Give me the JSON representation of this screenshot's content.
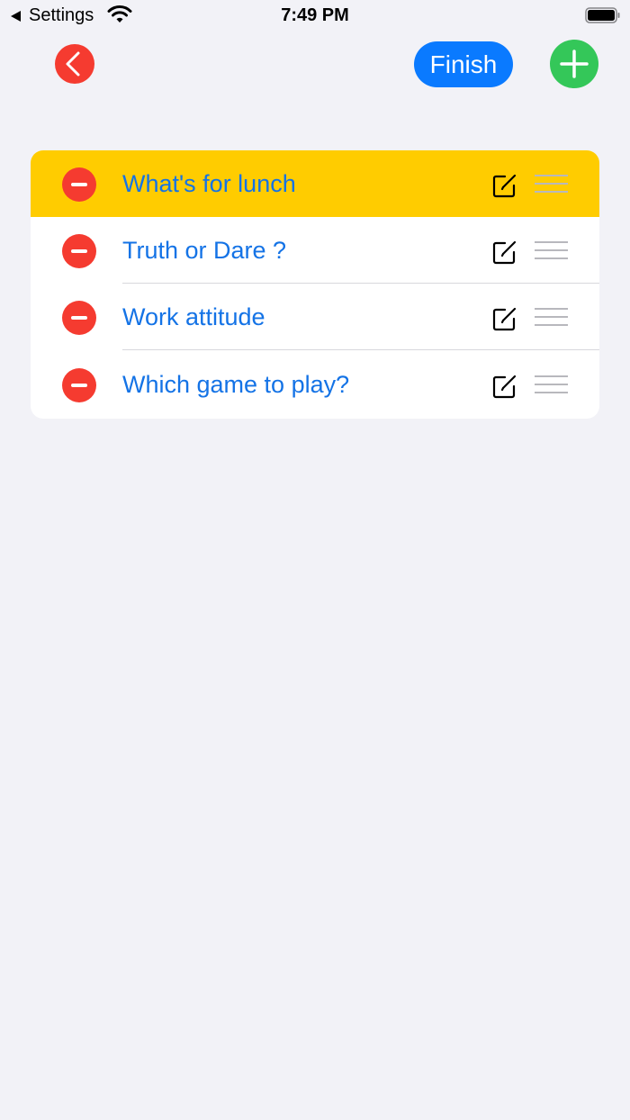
{
  "status_bar": {
    "back_label": "Settings",
    "time": "7:49 PM"
  },
  "toolbar": {
    "finish_label": "Finish"
  },
  "list": {
    "items": [
      {
        "label": "What's for lunch",
        "highlighted": true
      },
      {
        "label": "Truth or Dare ?",
        "highlighted": false
      },
      {
        "label": "Work attitude",
        "highlighted": false
      },
      {
        "label": "Which game to play?",
        "highlighted": false
      }
    ]
  },
  "colors": {
    "background": "#f2f2f7",
    "back_button": "#f53b30",
    "finish_button": "#0a7aff",
    "add_button": "#34c759",
    "highlight_row": "#ffcc00",
    "item_text": "#1473e6",
    "delete_icon": "#f53b30"
  }
}
